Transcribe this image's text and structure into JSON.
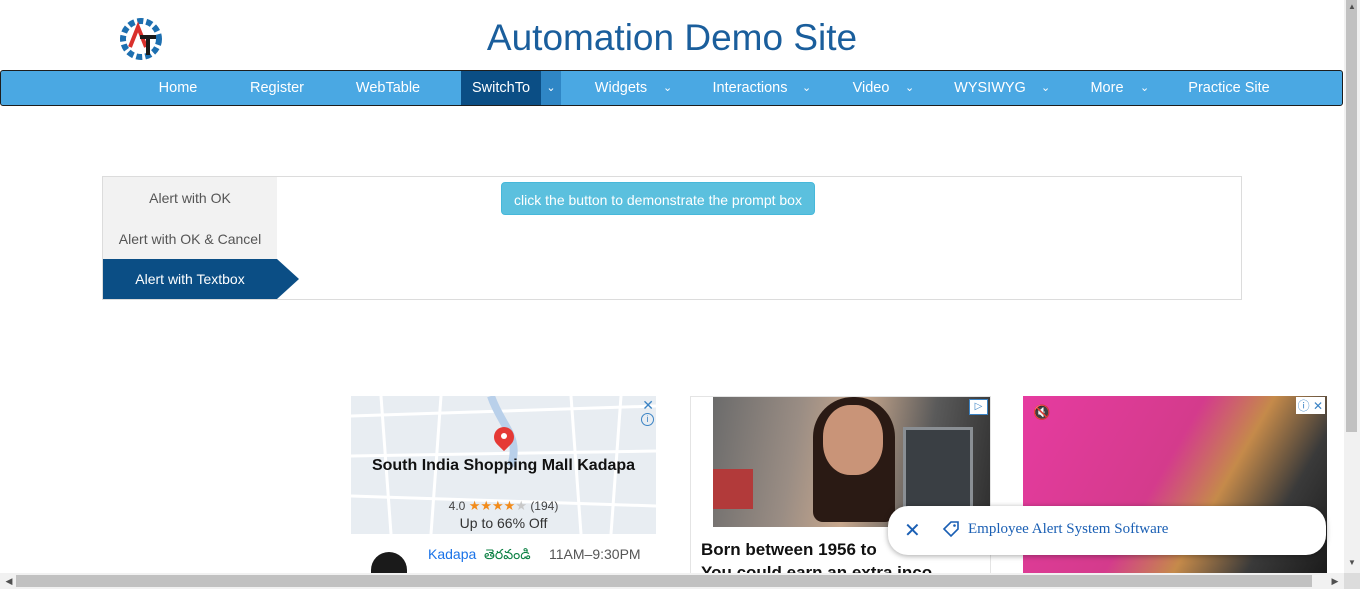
{
  "header": {
    "title": "Automation Demo Site"
  },
  "nav": {
    "items": [
      {
        "label": "Home"
      },
      {
        "label": "Register"
      },
      {
        "label": "WebTable"
      },
      {
        "label": "SwitchTo"
      },
      {
        "label": "Widgets"
      },
      {
        "label": "Interactions"
      },
      {
        "label": "Video"
      },
      {
        "label": "WYSIWYG"
      },
      {
        "label": "More"
      },
      {
        "label": "Practice Site"
      }
    ],
    "active": "SwitchTo",
    "colors": {
      "bar": "#4aa8e3",
      "active": "#0b4e85"
    }
  },
  "alerts": {
    "tabs": [
      {
        "label": "Alert with OK"
      },
      {
        "label": "Alert with OK & Cancel"
      },
      {
        "label": "Alert with Textbox"
      }
    ],
    "active_tab": "Alert with Textbox",
    "button_label": "click the button to demonstrate the prompt box"
  },
  "ads": {
    "map_ad": {
      "store": "South India Shopping Mall Kadapa",
      "rating": "4.0",
      "reviews": "(194)",
      "stars": 4,
      "offer": "Up to 66% Off",
      "city": "Kadapa",
      "open_status": "తెరవండి",
      "hours": "11AM–9:30PM"
    },
    "image_ad": {
      "headline_line1": "Born between 1956 to",
      "headline_line2": "You could earn an extra inco"
    }
  },
  "toast": {
    "text": "Employee Alert System Software"
  },
  "icons": {
    "close": "close-icon",
    "tag": "tag-icon",
    "mute": "mute-icon",
    "info": "info-icon"
  }
}
